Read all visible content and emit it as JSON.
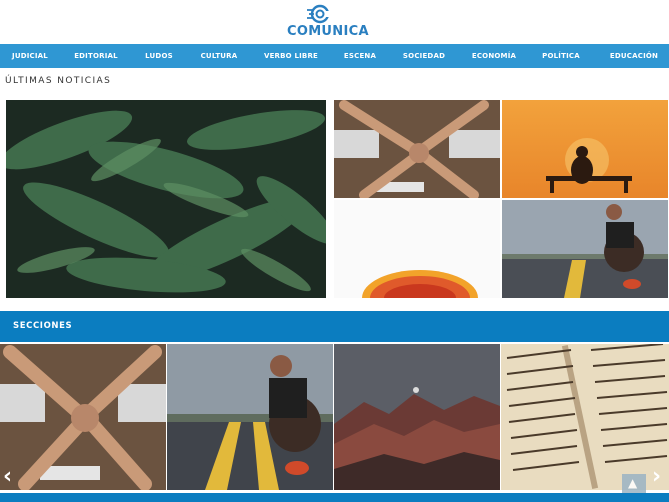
{
  "brand": {
    "name": "COMUNICA",
    "color": "#2a7fc0"
  },
  "nav": {
    "color": "#2f97d3",
    "items": [
      "JUDICIAL",
      "EDITORIAL",
      "LUDOS",
      "CULTURA",
      "VERBO LIBRE",
      "ESCENA",
      "SOCIEDAD",
      "ECONOMÍA",
      "POLÍTICA",
      "EDUCACIÓN"
    ]
  },
  "latest": {
    "title": "ÚLTIMAS NOTICIAS",
    "images": [
      "fern-leaves",
      "hands-stacked-laptops",
      "silhouette-bench-sunset",
      "orange-slice",
      "runner-tying-shoe-road"
    ]
  },
  "sections": {
    "title": "SECCIONES",
    "bar_color": "#0b7dc0",
    "images": [
      "hands-stacked-laptops",
      "runner-tying-shoe-road",
      "mountain-range-dusk",
      "old-book-text"
    ],
    "prev_icon": "chevron-left-icon",
    "next_icon": "chevron-right-icon"
  },
  "scroll_top_icon": "arrow-up-icon"
}
